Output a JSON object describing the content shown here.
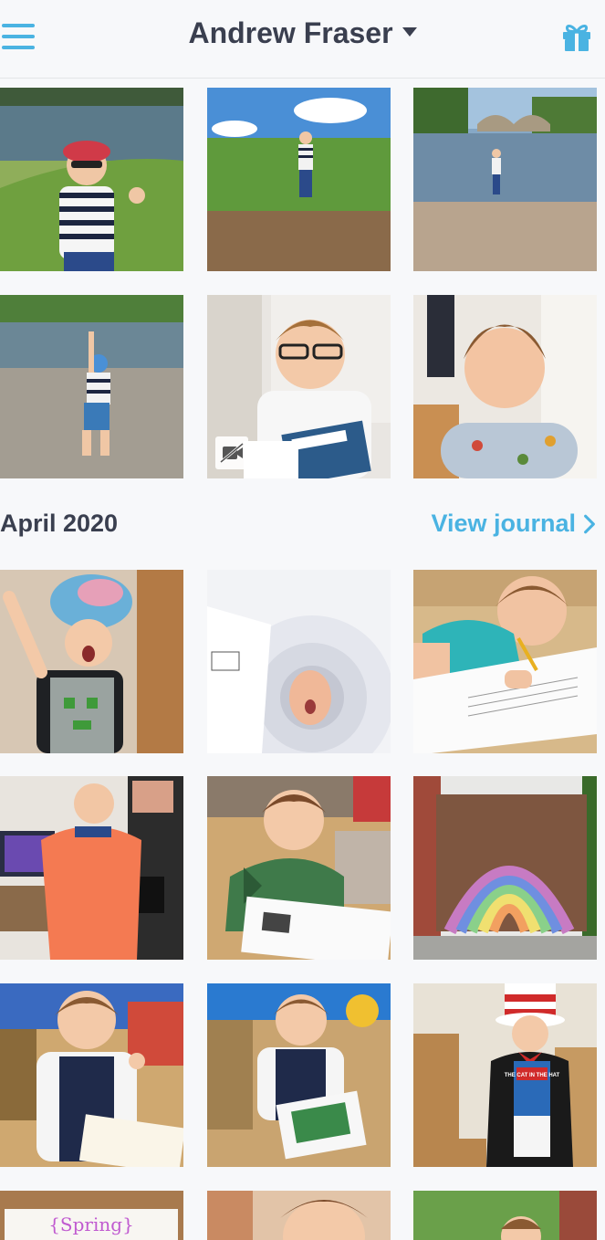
{
  "header": {
    "menu_icon": "hamburger-menu-icon",
    "title": "Andrew Fraser",
    "dropdown_icon": "caret-down-icon",
    "gift_icon": "gift-icon",
    "accent_color": "#4ab3e2"
  },
  "section": {
    "title": "April 2020",
    "view_journal_label": "View journal",
    "view_journal_icon": "chevron-right-icon"
  },
  "photos_top": [
    {
      "scene": "boy in striped shirt giving thumbs up by river"
    },
    {
      "scene": "boy standing on grassy bank under blue sky"
    },
    {
      "scene": "boy on rocky riverbank near stone bridge"
    },
    {
      "scene": "boy throwing stones into river"
    },
    {
      "scene": "boy with glasses holding book",
      "badge": "video-off-icon"
    },
    {
      "scene": "boy smiling in printed t-shirt"
    }
  ],
  "photos_april": [
    {
      "scene": "boy with towel on head"
    },
    {
      "scene": "boy face through paper tube"
    },
    {
      "scene": "boy writing at table"
    },
    {
      "scene": "boy in orange football shirt"
    },
    {
      "scene": "boy doing worksheet at table"
    },
    {
      "scene": "rainbow painted on wooden gate"
    },
    {
      "scene": "boy thumbs up at desk"
    },
    {
      "scene": "boy at desk with box"
    },
    {
      "scene": "boy dressed as cat in the hat"
    },
    {
      "scene": "spring artwork"
    },
    {
      "scene": "boy close up"
    },
    {
      "scene": "boy in garden"
    }
  ],
  "artwork_text": "{Spring}",
  "book_text": "THE CAT IN THE HAT"
}
